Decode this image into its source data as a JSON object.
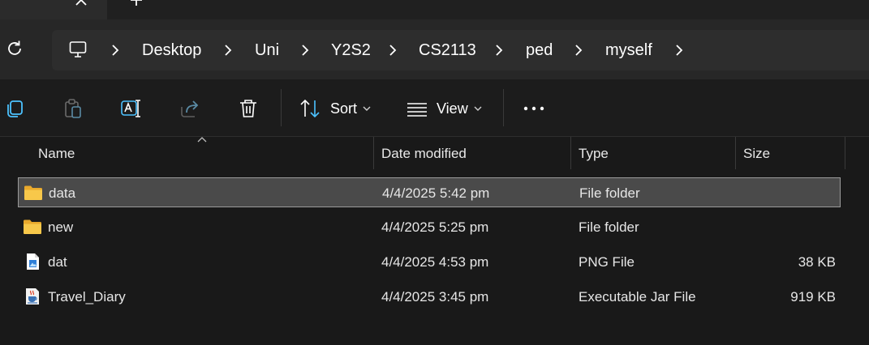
{
  "tabs": {
    "close_glyph": "✕",
    "new_glyph": "+"
  },
  "address": {
    "breadcrumbs": [
      "Desktop",
      "Uni",
      "Y2S2",
      "CS2113",
      "ped",
      "myself"
    ]
  },
  "toolbar": {
    "sort_label": "Sort",
    "view_label": "View"
  },
  "columns": {
    "name": "Name",
    "date": "Date modified",
    "type": "Type",
    "size": "Size"
  },
  "files": [
    {
      "name": "data",
      "date": "4/4/2025 5:42 pm",
      "type": "File folder",
      "size": "",
      "icon": "folder-icon",
      "selected": true
    },
    {
      "name": "new",
      "date": "4/4/2025 5:25 pm",
      "type": "File folder",
      "size": "",
      "icon": "folder-icon",
      "selected": false
    },
    {
      "name": "dat",
      "date": "4/4/2025 4:53 pm",
      "type": "PNG File",
      "size": "38 KB",
      "icon": "png-file-icon",
      "selected": false
    },
    {
      "name": "Travel_Diary",
      "date": "4/4/2025 3:45 pm",
      "type": "Executable Jar File",
      "size": "919 KB",
      "icon": "jar-file-icon",
      "selected": false
    }
  ],
  "colors": {
    "accent": "#4cc2ff",
    "folder": "#f8c84a",
    "selection": "#4a4a4a"
  }
}
